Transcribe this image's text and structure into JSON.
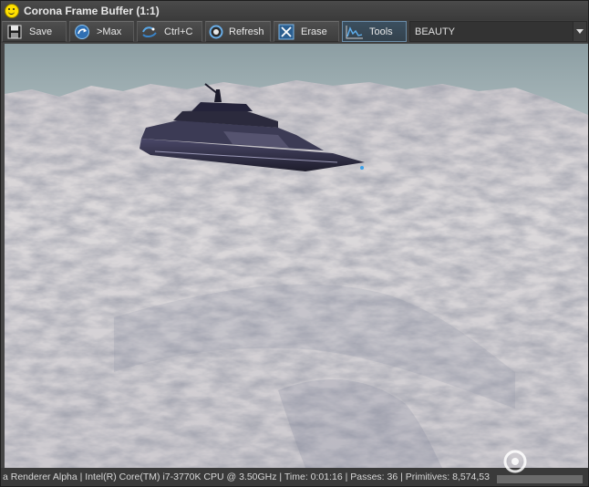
{
  "window": {
    "title": "Corona Frame Buffer (1:1)"
  },
  "toolbar": {
    "buttons": [
      {
        "label": "Save",
        "icon": "floppy-disk-icon"
      },
      {
        "label": ">Max",
        "icon": "send-to-max-icon"
      },
      {
        "label": "Ctrl+C",
        "icon": "copy-clipboard-icon"
      },
      {
        "label": "Refresh",
        "icon": "refresh-icon"
      },
      {
        "label": "Erase",
        "icon": "erase-icon"
      },
      {
        "label": "Tools",
        "icon": "tools-graph-icon"
      }
    ],
    "pass_select": {
      "value": "BEAUTY"
    }
  },
  "status": {
    "text": "a Renderer Alpha | Intel(R) Core(TM) i7-3770K CPU @ 3.50GHz | Time: 0:01:16 | Passes: 36 | Primitives: 8,574,53"
  },
  "colors": {
    "window_bg": "#464646",
    "title_text": "#e8e8e8",
    "toolbar_bg": "#3e3e3e",
    "active_button": "#3b4f5f",
    "icon_blue": "#5aa8e8",
    "sky": "#8aa0a6",
    "snow": "#d9d6d8"
  }
}
